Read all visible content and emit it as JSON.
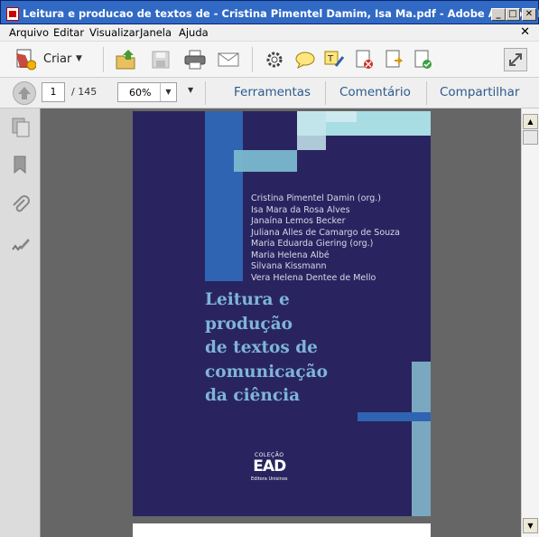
{
  "window": {
    "title": "Leitura e producao de textos de - Cristina Pimentel Damim, Isa Ma.pdf - Adobe Acrobat Pro",
    "minimize": "_",
    "maximize": "□",
    "close": "✕"
  },
  "menu": {
    "items": [
      "Arquivo",
      "Editar",
      "Visualizar",
      "Janela",
      "Ajuda"
    ],
    "close": "✕"
  },
  "toolbar": {
    "create_label": "Criar"
  },
  "nav": {
    "page": "1",
    "total": "/ 145",
    "zoom": "60%",
    "tabs": [
      "Ferramentas",
      "Comentário",
      "Compartilhar"
    ]
  },
  "document": {
    "authors": [
      "Cristina Pimentel Damin (org.)",
      "Isa Mara da Rosa Alves",
      "Janaína Lemos Becker",
      "Juliana Alles de Camargo de Souza",
      "Maria Eduarda Giering (org.)",
      "Maria Helena Albé",
      "Silvana Kissmann",
      "Vera Helena Dentee de Mello"
    ],
    "title": "Leitura e\nprodução\nde textos de\ncomunicação\nda ciência",
    "collection_label": "COLEÇÃO",
    "collection_logo": "EAD",
    "publisher": "Editora Unisinos"
  },
  "colors": {
    "titlebar": "#316ac5",
    "cover_bg": "#29245f",
    "accent_blue": "#2f64b2",
    "accent_cyan": "#a8dde4",
    "tab_text": "#2d5a8c"
  }
}
